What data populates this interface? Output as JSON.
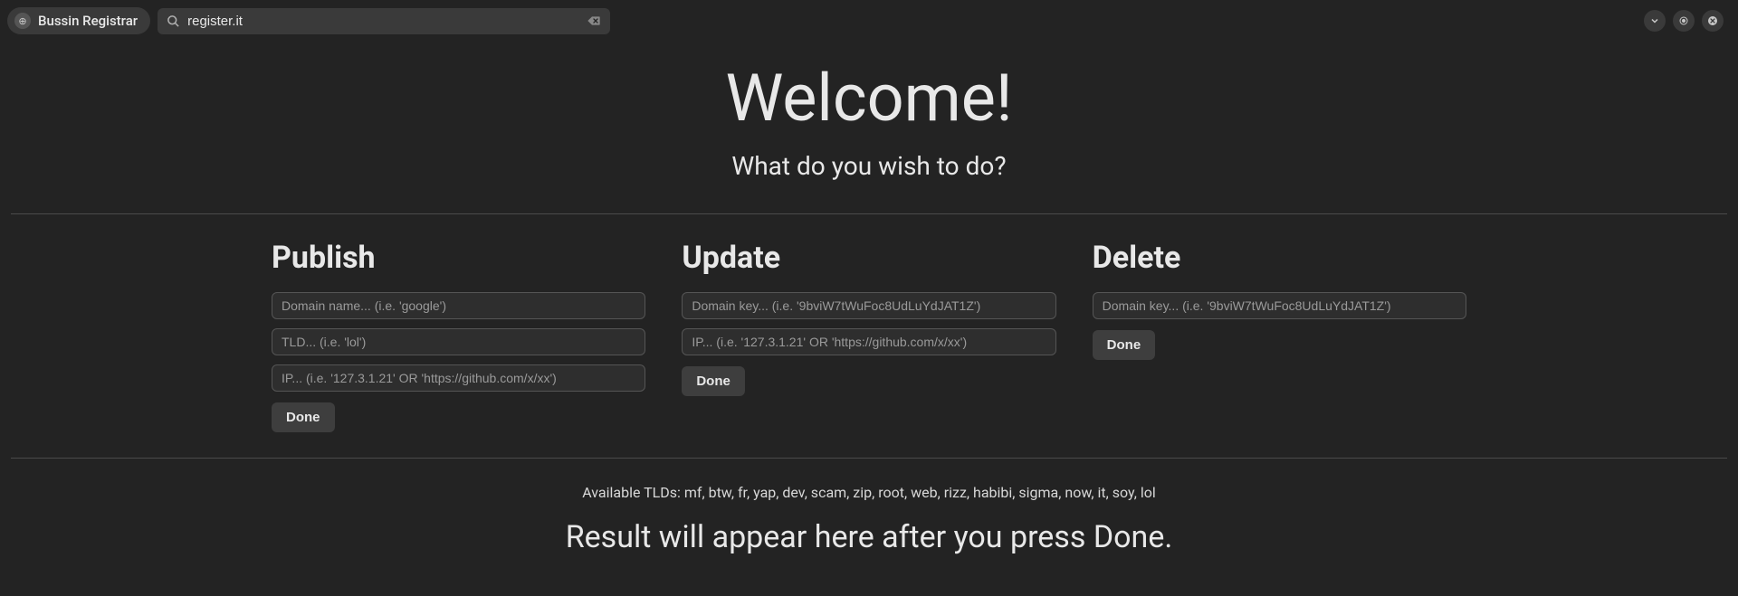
{
  "topbar": {
    "app_name": "Bussin Registrar",
    "url_value": "register.it"
  },
  "page": {
    "title": "Welcome!",
    "subtitle": "What do you wish to do?"
  },
  "publish": {
    "heading": "Publish",
    "domain_placeholder": "Domain name... (i.e. 'google')",
    "tld_placeholder": "TLD... (i.e. 'lol')",
    "ip_placeholder": "IP... (i.e. '127.3.1.21' OR 'https://github.com/x/xx')",
    "done_label": "Done"
  },
  "update": {
    "heading": "Update",
    "key_placeholder": "Domain key... (i.e. '9bviW7tWuFoc8UdLuYdJAT1Z')",
    "ip_placeholder": "IP... (i.e. '127.3.1.21' OR 'https://github.com/x/xx')",
    "done_label": "Done"
  },
  "delete": {
    "heading": "Delete",
    "key_placeholder": "Domain key... (i.e. '9bviW7tWuFoc8UdLuYdJAT1Z')",
    "done_label": "Done"
  },
  "footer": {
    "tlds": "Available TLDs: mf, btw, fr, yap, dev, scam, zip, root, web, rizz, habibi, sigma, now, it, soy, lol",
    "result": "Result will appear here after you press Done."
  }
}
